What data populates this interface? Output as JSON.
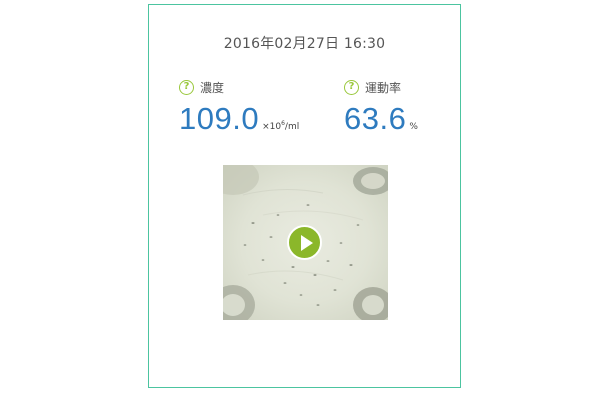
{
  "timestamp": "2016年02月27日 16:30",
  "concentration": {
    "label": "濃度",
    "value": "109.0",
    "unit_prefix": "×10",
    "unit_exp": "6",
    "unit_suffix": "/ml",
    "icon": "help-question-icon"
  },
  "motility": {
    "label": "運動率",
    "value": "63.6",
    "unit": "%",
    "icon": "help-question-icon"
  },
  "video": {
    "icon": "play-icon"
  },
  "colors": {
    "accent_border": "#4cc4a0",
    "value_blue": "#2e7bbf",
    "icon_green": "#9ac83c",
    "play_green": "#8bb72a"
  }
}
